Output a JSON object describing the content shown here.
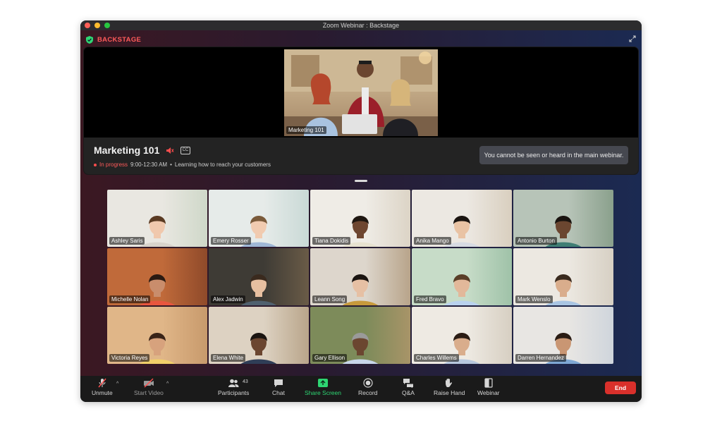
{
  "window": {
    "title": "Zoom Webinar : Backstage"
  },
  "backstage": {
    "label": "BACKSTAGE"
  },
  "stage": {
    "video_label": "Marketing 101",
    "session_title": "Marketing 101",
    "status": "In progress",
    "time": "9:00-12:30 AM",
    "separator": "•",
    "description": "Learning how to reach your customers",
    "notice": "You cannot be seen or heard in the main webinar."
  },
  "participants": [
    {
      "name": "Ashley Saris"
    },
    {
      "name": "Emery Rosser"
    },
    {
      "name": "Tiana Dokidis"
    },
    {
      "name": "Anika Mango"
    },
    {
      "name": "Antonio Burton"
    },
    {
      "name": "Michelle Nolan"
    },
    {
      "name": "Alex Jadwin"
    },
    {
      "name": "Leann Song"
    },
    {
      "name": "Fred Bravo"
    },
    {
      "name": "Mark Wenslo"
    },
    {
      "name": "Victoria Reyes"
    },
    {
      "name": "Elena White"
    },
    {
      "name": "Gary Ellison"
    },
    {
      "name": "Charles Willems"
    },
    {
      "name": "Darren Hernandez"
    }
  ],
  "toolbar": {
    "unmute": "Unmute",
    "start_video": "Start Video",
    "participants": "Participants",
    "participants_count": "43",
    "chat": "Chat",
    "share_screen": "Share Screen",
    "record": "Record",
    "qa": "Q&A",
    "raise_hand": "Raise Hand",
    "webinar": "Webinar",
    "end": "End"
  },
  "colors": {
    "accent_green": "#2ed673",
    "end_red": "#d9302b",
    "backstage_red": "#ff5a5a"
  }
}
